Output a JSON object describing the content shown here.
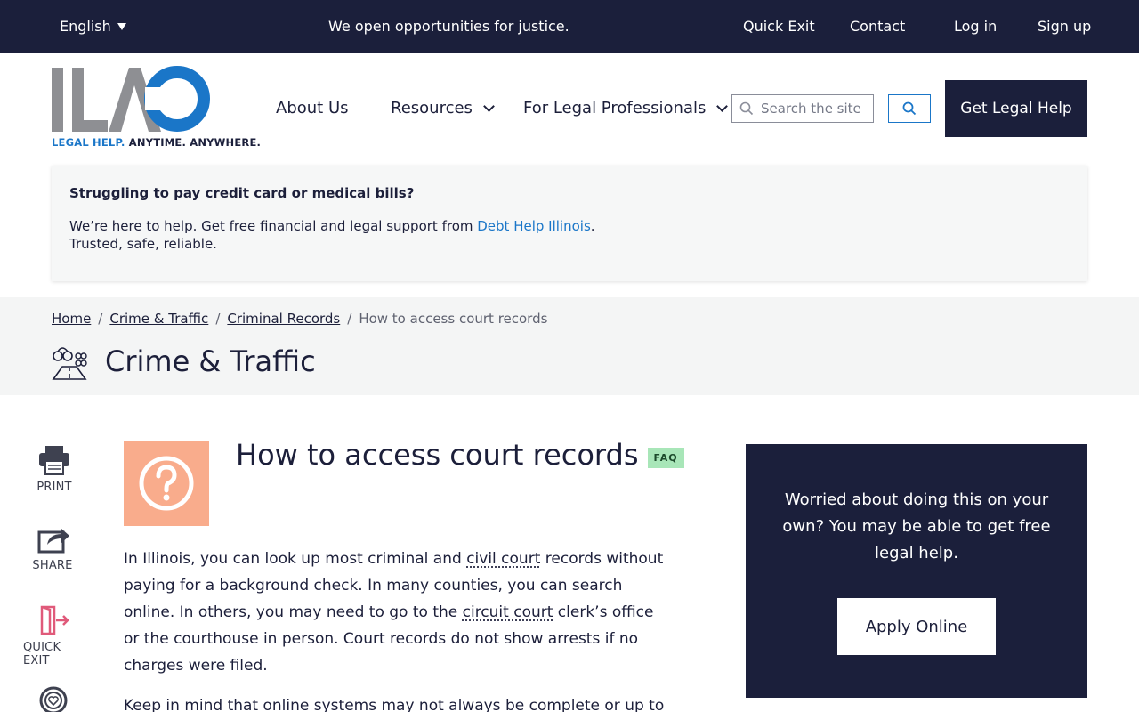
{
  "topbar": {
    "language": "English",
    "tagline": "We open opportunities for justice.",
    "quick_exit": "Quick Exit",
    "contact": "Contact",
    "login": "Log in",
    "signup": "Sign up"
  },
  "logo": {
    "letters": "ILAO",
    "tagline_part1": "LEGAL HELP.",
    "tagline_part2": " ANYTIME. ANYWHERE."
  },
  "nav": {
    "about": "About Us",
    "resources": "Resources",
    "professionals": "For Legal Professionals",
    "search_placeholder": "Search the site",
    "get_help": "Get Legal Help"
  },
  "banner": {
    "title": "Struggling to pay credit card or medical bills?",
    "body_prefix": "We’re here to help. Get free financial and legal support from ",
    "link": "Debt Help Illinois",
    "body_suffix": ".",
    "body_line2": "Trusted, safe, reliable."
  },
  "breadcrumb": {
    "items": [
      "Home",
      "Crime & Traffic",
      "Criminal Records"
    ],
    "current": "How to access court records",
    "separator": "/"
  },
  "category": {
    "title": "Crime & Traffic"
  },
  "rail": {
    "print": "PRINT",
    "share": "SHARE",
    "quick_exit": "QUICK EXIT"
  },
  "article": {
    "title": "How to access court records",
    "badge": "FAQ",
    "p1_a": "In Illinois, you can look up most criminal and ",
    "p1_term1": "civil court",
    "p1_b": " records without paying for a background check. In many counties, you can search online. In others, you may need to go to the ",
    "p1_term2": "circuit court",
    "p1_c": " clerk’s office or the courthouse in person. Court records do not show arrests if no charges were filed.",
    "p2": "Keep in mind that online systems may not always be complete or up to"
  },
  "cta": {
    "text": "Worried about doing this on your own?  You may be able to get free legal help.",
    "button": "Apply Online"
  },
  "colors": {
    "navy": "#1b1f3b",
    "blue": "#1a76c8",
    "gray_logo": "#8e8f93",
    "faq_orange": "#f9ac8c",
    "faq_badge_green": "#a8e6b8",
    "quick_exit_pink": "#e05a7a"
  }
}
